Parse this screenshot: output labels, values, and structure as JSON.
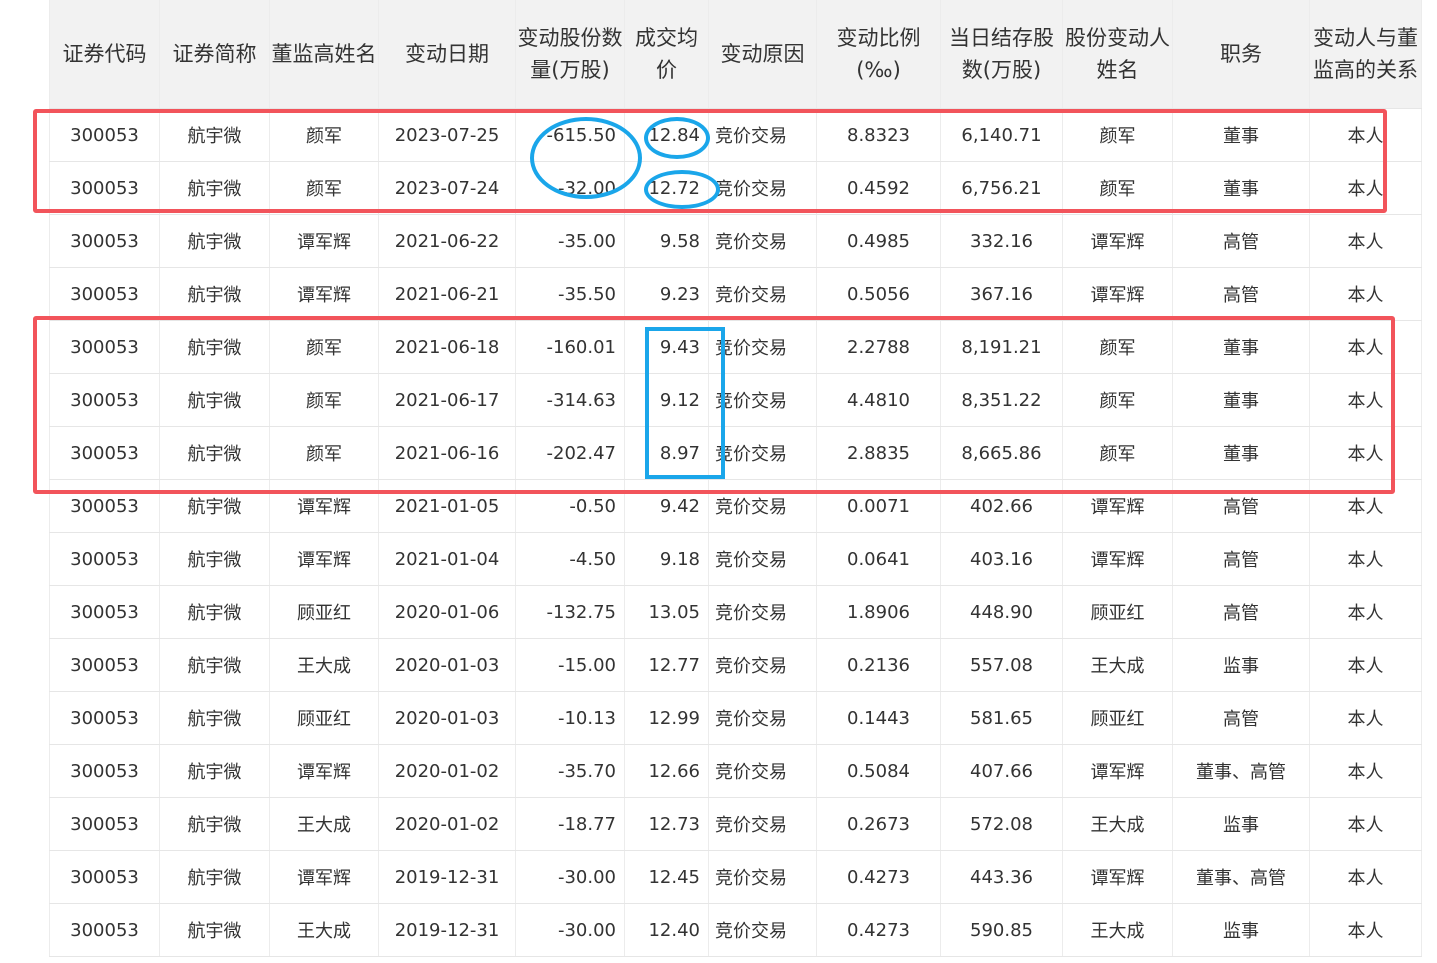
{
  "colors": {
    "header_bg": "#f2f2f2",
    "highlight_red": "#f2545b",
    "highlight_blue": "#1aa6ea"
  },
  "table": {
    "headers": [
      "证券代码",
      "证券简称",
      "董监高姓名",
      "变动日期",
      "变动股份数量(万股)",
      "成交均价",
      "变动原因",
      "变动比例(‰)",
      "当日结存股数(万股)",
      "股份变动人姓名",
      "职务",
      "变动人与董监高的关系"
    ],
    "rows": [
      [
        "300053",
        "航宇微",
        "颜军",
        "2023-07-25",
        "-615.50",
        "12.84",
        "竞价交易",
        "8.8323",
        "6,140.71",
        "颜军",
        "董事",
        "本人"
      ],
      [
        "300053",
        "航宇微",
        "颜军",
        "2023-07-24",
        "-32.00",
        "12.72",
        "竞价交易",
        "0.4592",
        "6,756.21",
        "颜军",
        "董事",
        "本人"
      ],
      [
        "300053",
        "航宇微",
        "谭军辉",
        "2021-06-22",
        "-35.00",
        "9.58",
        "竞价交易",
        "0.4985",
        "332.16",
        "谭军辉",
        "高管",
        "本人"
      ],
      [
        "300053",
        "航宇微",
        "谭军辉",
        "2021-06-21",
        "-35.50",
        "9.23",
        "竞价交易",
        "0.5056",
        "367.16",
        "谭军辉",
        "高管",
        "本人"
      ],
      [
        "300053",
        "航宇微",
        "颜军",
        "2021-06-18",
        "-160.01",
        "9.43",
        "竞价交易",
        "2.2788",
        "8,191.21",
        "颜军",
        "董事",
        "本人"
      ],
      [
        "300053",
        "航宇微",
        "颜军",
        "2021-06-17",
        "-314.63",
        "9.12",
        "竞价交易",
        "4.4810",
        "8,351.22",
        "颜军",
        "董事",
        "本人"
      ],
      [
        "300053",
        "航宇微",
        "颜军",
        "2021-06-16",
        "-202.47",
        "8.97",
        "竞价交易",
        "2.8835",
        "8,665.86",
        "颜军",
        "董事",
        "本人"
      ],
      [
        "300053",
        "航宇微",
        "谭军辉",
        "2021-01-05",
        "-0.50",
        "9.42",
        "竞价交易",
        "0.0071",
        "402.66",
        "谭军辉",
        "高管",
        "本人"
      ],
      [
        "300053",
        "航宇微",
        "谭军辉",
        "2021-01-04",
        "-4.50",
        "9.18",
        "竞价交易",
        "0.0641",
        "403.16",
        "谭军辉",
        "高管",
        "本人"
      ],
      [
        "300053",
        "航宇微",
        "顾亚红",
        "2020-01-06",
        "-132.75",
        "13.05",
        "竞价交易",
        "1.8906",
        "448.90",
        "顾亚红",
        "高管",
        "本人"
      ],
      [
        "300053",
        "航宇微",
        "王大成",
        "2020-01-03",
        "-15.00",
        "12.77",
        "竞价交易",
        "0.2136",
        "557.08",
        "王大成",
        "监事",
        "本人"
      ],
      [
        "300053",
        "航宇微",
        "顾亚红",
        "2020-01-03",
        "-10.13",
        "12.99",
        "竞价交易",
        "0.1443",
        "581.65",
        "顾亚红",
        "高管",
        "本人"
      ],
      [
        "300053",
        "航宇微",
        "谭军辉",
        "2020-01-02",
        "-35.70",
        "12.66",
        "竞价交易",
        "0.5084",
        "407.66",
        "谭军辉",
        "董事、高管",
        "本人"
      ],
      [
        "300053",
        "航宇微",
        "王大成",
        "2020-01-02",
        "-18.77",
        "12.73",
        "竞价交易",
        "0.2673",
        "572.08",
        "王大成",
        "监事",
        "本人"
      ],
      [
        "300053",
        "航宇微",
        "谭军辉",
        "2019-12-31",
        "-30.00",
        "12.45",
        "竞价交易",
        "0.4273",
        "443.36",
        "谭军辉",
        "董事、高管",
        "本人"
      ],
      [
        "300053",
        "航宇微",
        "王大成",
        "2019-12-31",
        "-30.00",
        "12.40",
        "竞价交易",
        "0.4273",
        "590.85",
        "王大成",
        "监事",
        "本人"
      ]
    ]
  }
}
